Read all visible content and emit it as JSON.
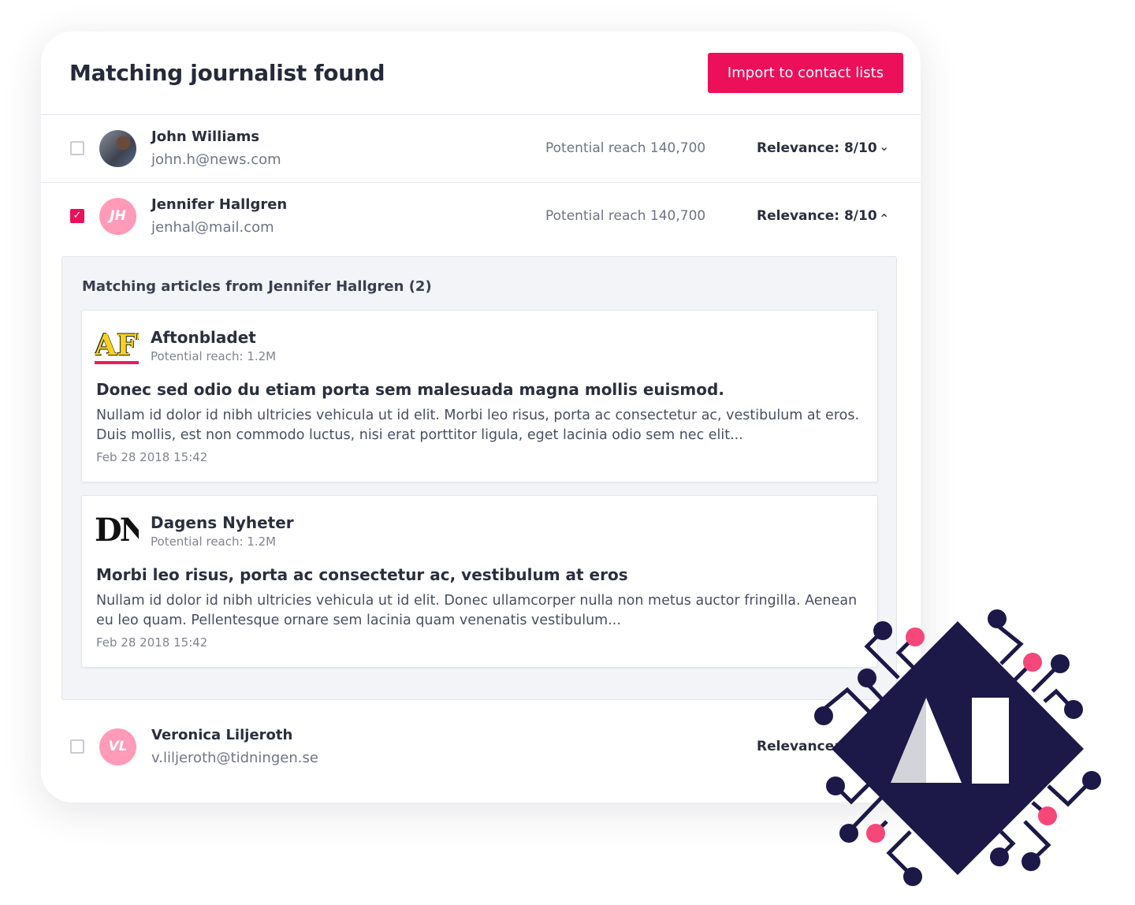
{
  "header": {
    "title": "Matching journalist found",
    "import_label": "Import to contact lists"
  },
  "journalists": [
    {
      "name": "John Williams",
      "email": "john.h@news.com",
      "reach": "Potential reach 140,700",
      "relevance": "Relevance: 8/10",
      "checked": false,
      "expanded": false
    },
    {
      "name": "Jennifer Hallgren",
      "initials": "JH",
      "email": "jenhal@mail.com",
      "reach": "Potential reach 140,700",
      "relevance": "Relevance: 8/10",
      "checked": true,
      "expanded": true
    },
    {
      "name": "Veronica Liljeroth",
      "initials": "VL",
      "email": "v.liljeroth@tidningen.se",
      "relevance": "Relevance: 8/10",
      "checked": false
    }
  ],
  "panel": {
    "title": "Matching articles from Jennifer Hallgren (2)",
    "articles": [
      {
        "logo": "AFT",
        "source": "Aftonbladet",
        "reach": "Potential reach: 1.2M",
        "headline": "Donec sed odio du etiam porta sem malesuada magna mollis euismod.",
        "body": "Nullam id dolor id nibh ultricies vehicula ut id elit. Morbi leo risus, porta ac consectetur ac, vestibulum at eros. Duis mollis, est non commodo luctus, nisi erat porttitor ligula, eget lacinia odio sem nec elit...",
        "date": "Feb 28 2018 15:42"
      },
      {
        "logo": "DN.",
        "source": "Dagens Nyheter",
        "reach": "Potential reach: 1.2M",
        "headline": "Morbi leo risus, porta ac consectetur ac, vestibulum at eros",
        "body": "Nullam id dolor id nibh ultricies vehicula ut id elit. Donec ullamcorper nulla non metus auctor fringilla. Aenean eu leo quam. Pellentesque ornare sem lacinia quam venenatis vestibulum...",
        "date": "Feb 28 2018 15:42"
      }
    ]
  },
  "colors": {
    "accent": "#ec0f5a",
    "avatar": "#ff9bb8",
    "logo_navy": "#1c1848",
    "logo_pink": "#f5477a"
  },
  "icons": {
    "expand": "chevron-down-icon",
    "collapse": "chevron-up-icon",
    "check": "checkmark-icon"
  }
}
